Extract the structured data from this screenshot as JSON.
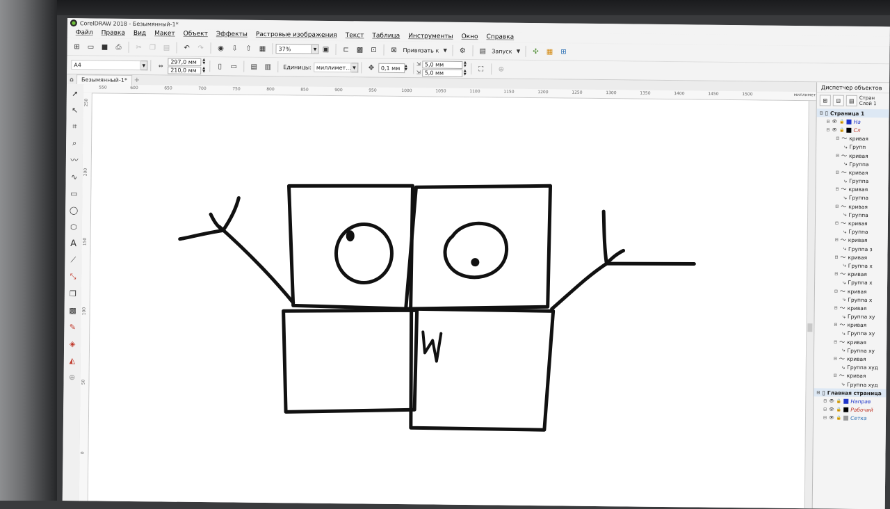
{
  "window": {
    "title": "CorelDRAW 2018 - Безымянный-1*"
  },
  "menu": [
    "Файл",
    "Правка",
    "Вид",
    "Макет",
    "Объект",
    "Эффекты",
    "Растровые изображения",
    "Текст",
    "Таблица",
    "Инструменты",
    "Окно",
    "Справка"
  ],
  "toolbar1": {
    "zoom": "37%",
    "snap_label": "Привязать к",
    "launch_label": "Запуск"
  },
  "toolbar2": {
    "page_size": "A4",
    "width": "297,0 мм",
    "height": "210,0 мм",
    "units_label": "Единицы:",
    "units_value": "миллимет...",
    "nudge": "0,1 мм",
    "dup_x": "5,0 мм",
    "dup_y": "5,0 мм"
  },
  "tabs": {
    "document": "Безымянный-1*"
  },
  "ruler": {
    "h_ticks": [
      "550",
      "600",
      "650",
      "700",
      "750",
      "800",
      "850",
      "900",
      "950",
      "1000",
      "1050",
      "1100",
      "1150",
      "1200",
      "1250",
      "1300",
      "1350",
      "1400",
      "1450",
      "1500"
    ],
    "v_ticks": [
      "250",
      "200",
      "150",
      "100",
      "50",
      "0"
    ],
    "units": "миллиметры"
  },
  "docker": {
    "title": "Диспетчер объектов",
    "page_info": [
      "Стран",
      "Слой 1"
    ],
    "tree": [
      {
        "level": 0,
        "type": "page",
        "label": "Страница 1"
      },
      {
        "level": 1,
        "type": "layer",
        "label": "На",
        "color": "#1f35c9"
      },
      {
        "level": 1,
        "type": "layer",
        "label": "Сл",
        "color": "#000000"
      },
      {
        "level": 2,
        "type": "curve",
        "label": "кривая"
      },
      {
        "level": 3,
        "type": "group",
        "label": "Групп"
      },
      {
        "level": 2,
        "type": "curve",
        "label": "кривая"
      },
      {
        "level": 3,
        "type": "group",
        "label": "Группа"
      },
      {
        "level": 2,
        "type": "curve",
        "label": "кривая"
      },
      {
        "level": 3,
        "type": "group",
        "label": "Группа"
      },
      {
        "level": 2,
        "type": "curve",
        "label": "кривая"
      },
      {
        "level": 3,
        "type": "group",
        "label": "Группа"
      },
      {
        "level": 2,
        "type": "curve",
        "label": "кривая"
      },
      {
        "level": 3,
        "type": "group",
        "label": "Группа"
      },
      {
        "level": 2,
        "type": "curve",
        "label": "кривая"
      },
      {
        "level": 3,
        "type": "group",
        "label": "Группа"
      },
      {
        "level": 2,
        "type": "curve",
        "label": "кривая"
      },
      {
        "level": 3,
        "type": "group",
        "label": "Группа з"
      },
      {
        "level": 2,
        "type": "curve",
        "label": "кривая"
      },
      {
        "level": 3,
        "type": "group",
        "label": "Группа х"
      },
      {
        "level": 2,
        "type": "curve",
        "label": "кривая"
      },
      {
        "level": 3,
        "type": "group",
        "label": "Группа х"
      },
      {
        "level": 2,
        "type": "curve",
        "label": "кривая"
      },
      {
        "level": 3,
        "type": "group",
        "label": "Группа х"
      },
      {
        "level": 2,
        "type": "curve",
        "label": "кривая"
      },
      {
        "level": 3,
        "type": "group",
        "label": "Группа ху"
      },
      {
        "level": 2,
        "type": "curve",
        "label": "кривая"
      },
      {
        "level": 3,
        "type": "group",
        "label": "Группа ху"
      },
      {
        "level": 2,
        "type": "curve",
        "label": "кривая"
      },
      {
        "level": 3,
        "type": "group",
        "label": "Группа ху"
      },
      {
        "level": 2,
        "type": "curve",
        "label": "кривая"
      },
      {
        "level": 3,
        "type": "group",
        "label": "Группа худ"
      },
      {
        "level": 2,
        "type": "curve",
        "label": "кривая"
      },
      {
        "level": 3,
        "type": "group",
        "label": "Группа худ"
      },
      {
        "level": 0,
        "type": "page",
        "label": "Главная страница"
      },
      {
        "level": 1,
        "type": "layer",
        "label": "Направ",
        "color": "#1f35c9",
        "italic": true
      },
      {
        "level": 1,
        "type": "layer",
        "label": "Рабочий",
        "color": "#000000",
        "italic": true
      },
      {
        "level": 1,
        "type": "layer",
        "label": "Сетка",
        "color": "#9a9a9a",
        "italic": true
      }
    ]
  }
}
